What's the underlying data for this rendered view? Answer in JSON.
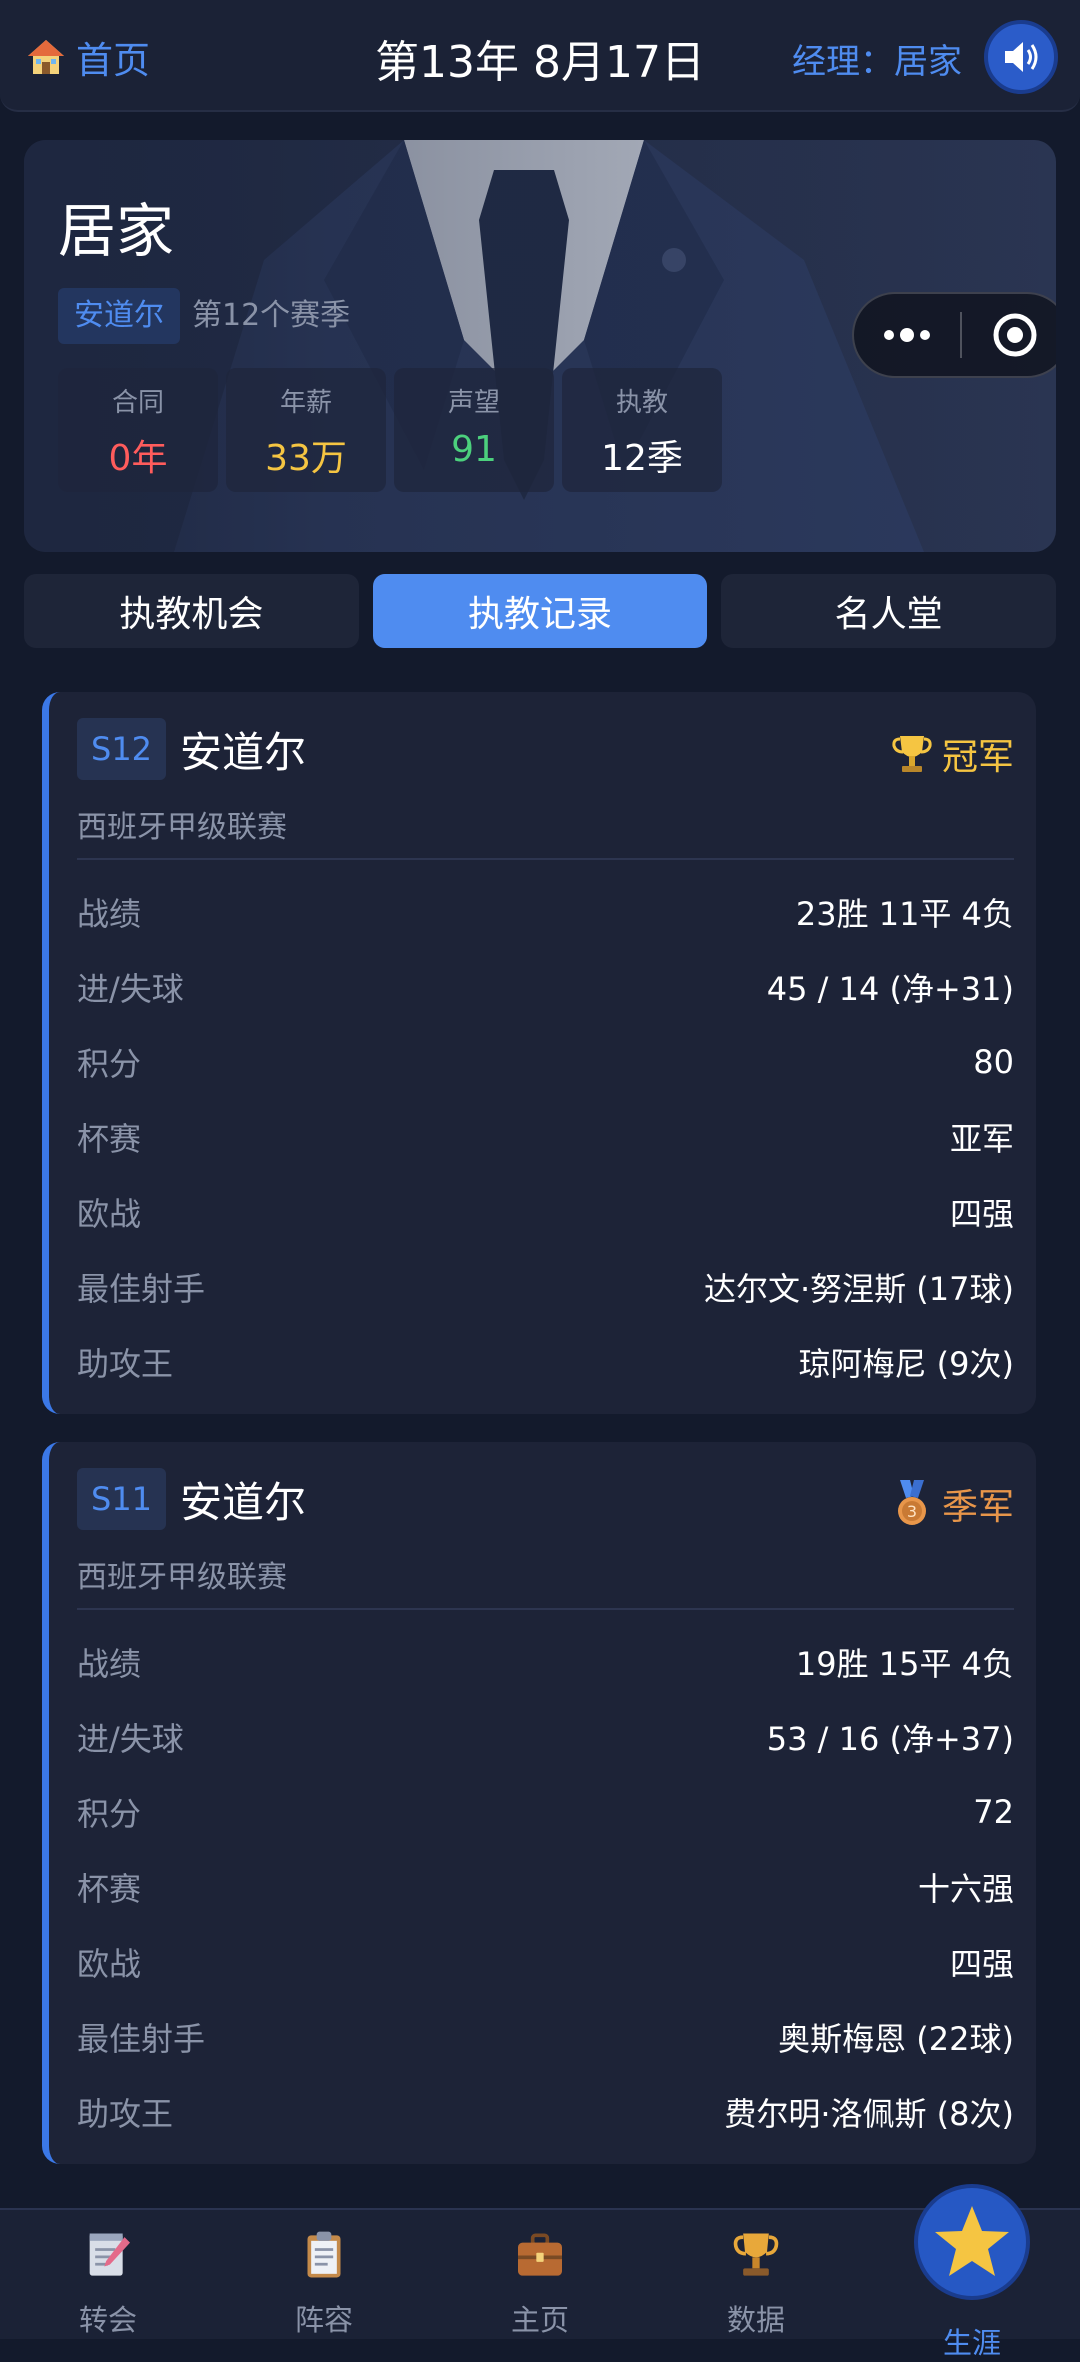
{
  "topbar": {
    "home_label": "首页",
    "game_date": "第13年 8月17日",
    "manager_label": "经理：居家"
  },
  "profile": {
    "name": "居家",
    "team": "安道尔",
    "season_label": "第12个赛季",
    "stats": [
      {
        "label": "合同",
        "value": "0年",
        "color": "#ff5c5c"
      },
      {
        "label": "年薪",
        "value": "33万",
        "color": "#f5c542"
      },
      {
        "label": "声望",
        "value": "91",
        "color": "#4cd07d"
      },
      {
        "label": "执教",
        "value": "12季",
        "color": "#ffffff"
      }
    ]
  },
  "tabs": [
    {
      "label": "执教机会",
      "active": false
    },
    {
      "label": "执教记录",
      "active": true
    },
    {
      "label": "名人堂",
      "active": false
    }
  ],
  "records": [
    {
      "season": "S12",
      "team": "安道尔",
      "honor": "冠军",
      "honor_icon": "trophy-icon",
      "honor_color": "#f5c542",
      "league": "西班牙甲级联赛",
      "rows": [
        {
          "label": "战绩",
          "value": "23胜 11平 4负"
        },
        {
          "label": "进/失球",
          "value": "45 / 14 (净+31)"
        },
        {
          "label": "积分",
          "value": "80"
        },
        {
          "label": "杯赛",
          "value": "亚军"
        },
        {
          "label": "欧战",
          "value": "四强"
        },
        {
          "label": "最佳射手",
          "value": "达尔文·努涅斯 (17球)"
        },
        {
          "label": "助攻王",
          "value": "琼阿梅尼 (9次)"
        }
      ]
    },
    {
      "season": "S11",
      "team": "安道尔",
      "honor": "季军",
      "honor_icon": "bronze-medal-icon",
      "honor_color": "#e8964a",
      "league": "西班牙甲级联赛",
      "rows": [
        {
          "label": "战绩",
          "value": "19胜 15平 4负"
        },
        {
          "label": "进/失球",
          "value": "53 / 16 (净+37)"
        },
        {
          "label": "积分",
          "value": "72"
        },
        {
          "label": "杯赛",
          "value": "十六强"
        },
        {
          "label": "欧战",
          "value": "四强"
        },
        {
          "label": "最佳射手",
          "value": "奥斯梅恩 (22球)"
        },
        {
          "label": "助攻王",
          "value": "费尔明·洛佩斯 (8次)"
        }
      ]
    }
  ],
  "bottom_nav": [
    {
      "label": "转会",
      "icon": "notepad-pencil-icon",
      "active": false
    },
    {
      "label": "阵容",
      "icon": "clipboard-icon",
      "active": false
    },
    {
      "label": "主页",
      "icon": "briefcase-icon",
      "active": false
    },
    {
      "label": "数据",
      "icon": "trophy-icon",
      "active": false
    },
    {
      "label": "生涯",
      "icon": "star-icon",
      "active": true
    }
  ]
}
